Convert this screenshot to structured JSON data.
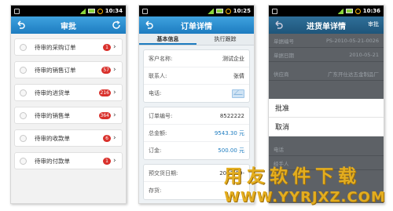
{
  "phone1": {
    "time": "10:34",
    "title": "审批",
    "items": [
      {
        "label": "待审的采购订单",
        "badge": "1"
      },
      {
        "label": "待审的销售订单",
        "badge": "57"
      },
      {
        "label": "待审的进货单",
        "badge": "216"
      },
      {
        "label": "待审的销售单",
        "badge": "364"
      },
      {
        "label": "待审的收款单",
        "badge": "6"
      },
      {
        "label": "待审的付款单",
        "badge": "1"
      }
    ]
  },
  "phone2": {
    "time": "10:25",
    "title": "订单详情",
    "tabs": [
      "基本信息",
      "执行跟踪"
    ],
    "customer_label": "客户名称:",
    "customer_value": "测试企业",
    "contact_label": "联系人:",
    "contact_value": "张倩",
    "phone_label": "电话:",
    "order_no_label": "订单编号:",
    "order_no_value": "8522222",
    "total_label": "总金额:",
    "total_value": "9543.30 元",
    "deposit_label": "订金:",
    "deposit_value": "500.00 元",
    "delivery_label": "预交货日期:",
    "delivery_value": "2012-09-",
    "warehouse_label": "存货:"
  },
  "phone3": {
    "time": "10:36",
    "title": "进货单详情",
    "approve_label": "审批",
    "rows": [
      {
        "k": "单据编号",
        "v": "PS-2010-05-21-0026"
      },
      {
        "k": "单据日期",
        "v": "2010-05-21"
      },
      {
        "k": "供应商",
        "v": "广东开仕达五金制品厂"
      }
    ],
    "lower_rows": [
      {
        "k": "电话",
        "v": ""
      },
      {
        "k": "经手人",
        "v": ""
      }
    ],
    "dialog": {
      "approve": "批准",
      "cancel": "取消"
    }
  },
  "watermark": {
    "chinese": "用友软件下载",
    "url": "WWW.YYRJXZ.COM"
  },
  "colors": {
    "titlebar": "#1d7cc0",
    "badge": "#d9312c",
    "watermark": "#e3ad1f"
  }
}
